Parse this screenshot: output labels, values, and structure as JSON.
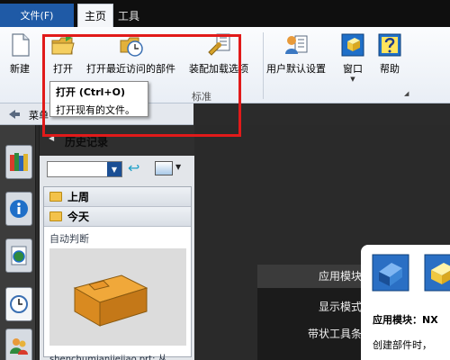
{
  "tabs": {
    "file_label": "文件(F)",
    "home_label": "主页",
    "tools_label": "工具"
  },
  "ribbon": {
    "new_label": "新建",
    "open_label": "打开",
    "recent_label": "打开最近访问的部件",
    "assembly_load_label": "装配加载选项",
    "user_defaults_label": "用户默认设置",
    "window_label": "窗口",
    "help_label": "帮助",
    "group_label": "标准"
  },
  "tooltip": {
    "title": "打开 (Ctrl+O)",
    "description": "打开现有的文件。"
  },
  "quick_bar": {
    "menu_label": "菜单"
  },
  "history_panel": {
    "title": "历史记录",
    "folders": [
      "上周",
      "今天"
    ],
    "section_label": "自动判断",
    "filename": "shenchumianjiejiao.prt: 从"
  },
  "graphics_menu": {
    "items": [
      "应用模块",
      "显示模式",
      "带状工具条"
    ]
  },
  "app_card": {
    "line1": "应用模块：NX",
    "line2": "创建部件时，"
  },
  "colors": {
    "file_tab": "#1f5aa6",
    "highlight": "#e11a1a"
  }
}
